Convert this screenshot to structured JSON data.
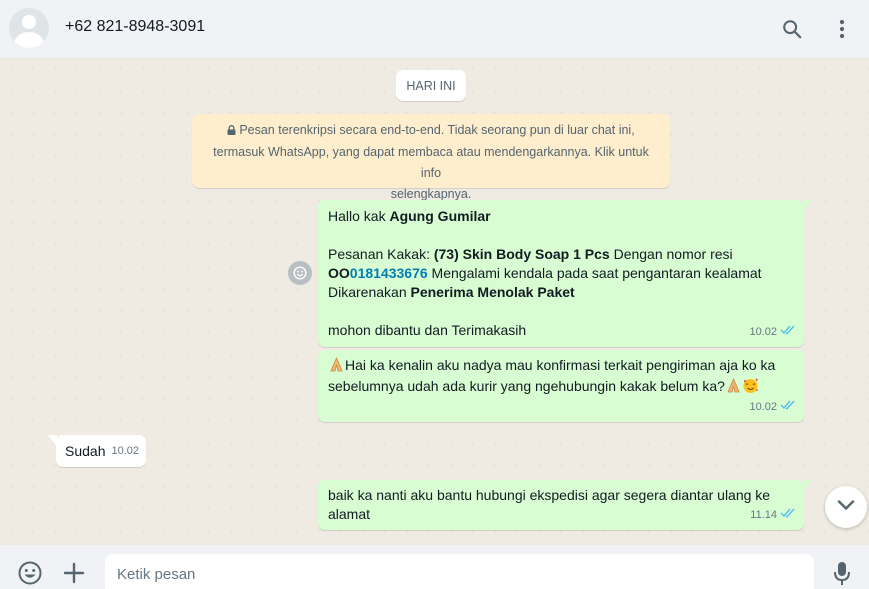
{
  "header": {
    "contact_name": "+62 821-8948-3091",
    "icons": [
      "avatar",
      "search-icon",
      "menu-icon"
    ]
  },
  "chat": {
    "day_label": "HARI INI",
    "encryption_notice": {
      "line1": "Pesan terenkripsi secara end-to-end. Tidak seorang pun di luar chat ini,",
      "line2": "termasuk WhatsApp, yang dapat membaca atau mendengarkannya. Klik untuk info",
      "line3": "selengkapnya."
    },
    "messages": [
      {
        "direction": "outgoing",
        "greeting_prefix": "Hallo kak ",
        "greeting_name": "Agung Gumilar",
        "order_label": "Pesanan Kakak: ",
        "order_product": "(73) Skin Body Soap 1 Pcs",
        "order_suffix": " Dengan nomor resi",
        "resi_prefix": "OO",
        "resi_link": "0181433676",
        "line3_rest": " Mengalami kendala pada saat pengantaran kealamat",
        "reason_label": "Dikarenakan ",
        "reason": "Penerima Menolak Paket",
        "closing": " mohon dibantu dan Terimakasih",
        "time": "10.02",
        "status": "read"
      },
      {
        "direction": "outgoing",
        "line1": "Hai ka kenalin aku nadya mau konfirmasi terkait pengiriman aja ko ka",
        "line2": "sebelumnya udah ada kurir yang ngehubungin kakak belum ka?",
        "emojis": [
          "folded-hands",
          "folded-hands",
          "smiling-face-with-hearts"
        ],
        "time": "10.02",
        "status": "read"
      },
      {
        "direction": "incoming",
        "text": "Sudah",
        "time": "10.02"
      },
      {
        "direction": "outgoing",
        "line1": "baik ka nanti aku bantu hubungi ekspedisi agar segera diantar ulang ke",
        "line2": "alamat",
        "time": "11.14",
        "status": "read"
      }
    ]
  },
  "composer": {
    "placeholder": "Ketik pesan",
    "value": ""
  },
  "colors": {
    "outgoing_bubble": "#d9fdd3",
    "incoming_bubble": "#ffffff",
    "notice_bubble": "#ffeecd",
    "read_tick": "#53bdeb",
    "link": "#027eb5"
  }
}
